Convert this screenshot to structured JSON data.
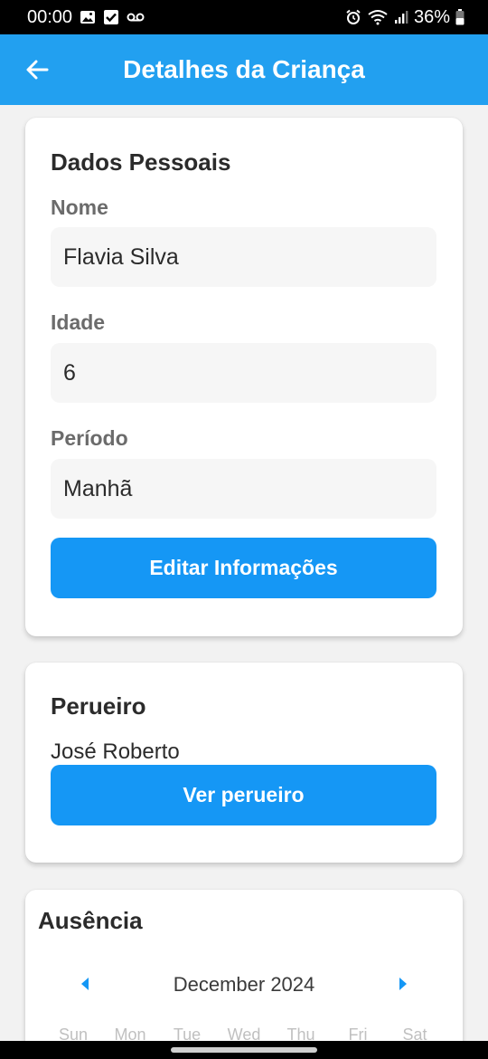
{
  "status_bar": {
    "time": "00:00",
    "battery": "36%",
    "icons": [
      "gallery-icon",
      "check-box-icon",
      "voicemail-icon",
      "alarm-icon",
      "wifi-icon",
      "signal-icon",
      "battery-icon"
    ]
  },
  "app_bar": {
    "title": "Detalhes da Criança",
    "back_icon": "arrow-back-icon",
    "color": "#22a0f0"
  },
  "personal": {
    "title": "Dados Pessoais",
    "name_label": "Nome",
    "name_value": "Flavia Silva",
    "age_label": "Idade",
    "age_value": "6",
    "period_label": "Período",
    "period_value": "Manhã",
    "edit_button": "Editar Informações"
  },
  "driver": {
    "title": "Perueiro",
    "name": "José Roberto",
    "view_button": "Ver perueiro"
  },
  "absence": {
    "title": "Ausência",
    "month": "December 2024",
    "prev_icon": "caret-left-icon",
    "next_icon": "caret-right-icon",
    "weekdays": [
      "Sun",
      "Mon",
      "Tue",
      "Wed",
      "Thu",
      "Fri",
      "Sat"
    ]
  },
  "colors": {
    "accent": "#1597f5",
    "app_bar": "#22a0f0",
    "background": "#f2f2f2"
  }
}
